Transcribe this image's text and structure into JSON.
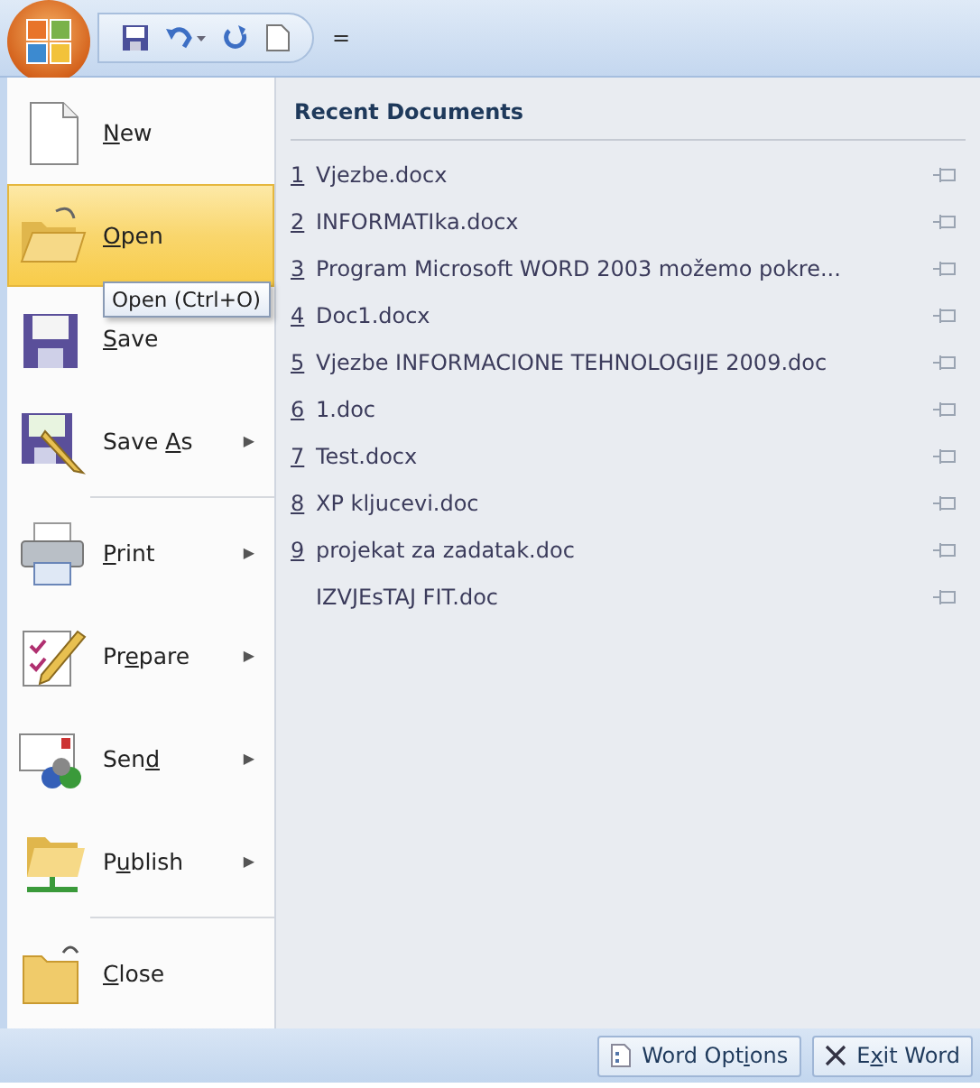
{
  "quick_access": {
    "customize": "="
  },
  "menu": [
    {
      "kind": "new",
      "label": {
        "key": "N",
        "after": "ew"
      },
      "selected": false
    },
    {
      "kind": "open",
      "label": {
        "key": "O",
        "after": "pen"
      },
      "selected": true
    },
    {
      "kind": "save",
      "label": {
        "key": "S",
        "after": "ave"
      },
      "selected": false
    },
    {
      "kind": "saveas",
      "label": {
        "before": "Save ",
        "key": "A",
        "after": "s"
      },
      "arrow": "▶",
      "selected": false
    },
    {
      "kind": "separator"
    },
    {
      "kind": "print",
      "label": {
        "key": "P",
        "after": "rint"
      },
      "arrow": "▶",
      "selected": false
    },
    {
      "kind": "prepare",
      "label": {
        "before": "Pr",
        "key": "e",
        "after": "pare"
      },
      "arrow": "▶",
      "selected": false
    },
    {
      "kind": "send",
      "label": {
        "before": "Sen",
        "key": "d"
      },
      "arrow": "▶",
      "selected": false
    },
    {
      "kind": "publish",
      "label": {
        "before": "P",
        "key": "u",
        "after": "blish"
      },
      "arrow": "▶",
      "selected": false
    },
    {
      "kind": "separator"
    },
    {
      "kind": "close",
      "label": {
        "key": "C",
        "after": "lose"
      },
      "selected": false
    }
  ],
  "tooltip": "Open (Ctrl+O)",
  "recent": {
    "title": "Recent Documents",
    "items": [
      {
        "number": "1",
        "name": "Vjezbe.docx"
      },
      {
        "number": "2",
        "name": "INFORMATIka.docx"
      },
      {
        "number": "3",
        "name": "Program Microsoft WORD 2003 možemo pokre..."
      },
      {
        "number": "4",
        "name": "Doc1.docx"
      },
      {
        "number": "5",
        "name": "Vjezbe INFORMACIONE TEHNOLOGIJE 2009.doc"
      },
      {
        "number": "6",
        "name": "1.doc"
      },
      {
        "number": "7",
        "name": "Test.docx"
      },
      {
        "number": "8",
        "name": "XP kljucevi.doc"
      },
      {
        "number": "9",
        "name": "projekat za zadatak.doc"
      },
      {
        "name": "IZVJEsTAJ FIT.doc"
      }
    ]
  },
  "footer": {
    "options": {
      "before": "Word Opt",
      "key": "i",
      "after": "ons"
    },
    "exit": {
      "before": "E",
      "key": "x",
      "after": "it Word"
    }
  }
}
